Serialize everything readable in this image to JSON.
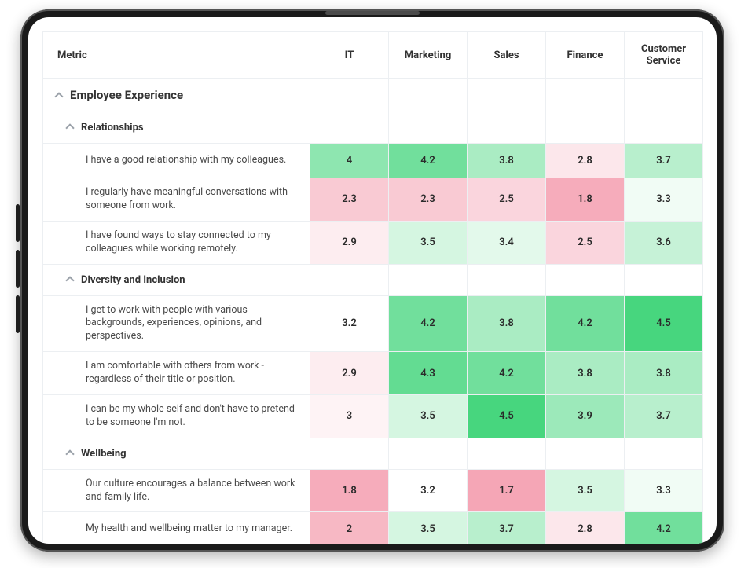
{
  "chart_data": {
    "type": "heatmap",
    "title": "Employee Experience",
    "columns": [
      "IT",
      "Marketing",
      "Sales",
      "Finance",
      "Customer Service"
    ],
    "color_scale": {
      "low": 1.5,
      "mid": 3.2,
      "high": 4.5,
      "low_color": "#f49aac",
      "mid_color": "#ffffff",
      "high_color": "#47d67e"
    },
    "sections": [
      {
        "name": "Relationships",
        "rows": [
          {
            "metric": "I have a good relationship with my colleagues.",
            "values": [
              4,
              4.2,
              3.8,
              2.8,
              3.7
            ]
          },
          {
            "metric": "I regularly have meaningful conversations with someone from work.",
            "values": [
              2.3,
              2.3,
              2.5,
              1.8,
              3.3
            ]
          },
          {
            "metric": "I have found ways to stay connected to my colleagues while working remotely.",
            "values": [
              2.9,
              3.5,
              3.4,
              2.5,
              3.6
            ]
          }
        ]
      },
      {
        "name": "Diversity and Inclusion",
        "rows": [
          {
            "metric": "I get to work with people with various backgrounds, experiences, opinions, and perspectives.",
            "values": [
              3.2,
              4.2,
              3.8,
              4.2,
              4.5
            ]
          },
          {
            "metric": "I am comfortable with others from work - regardless of their title or position.",
            "values": [
              2.9,
              4.3,
              4.2,
              3.8,
              3.8
            ]
          },
          {
            "metric": "I can be my whole self and don't have to pretend to be someone I'm not.",
            "values": [
              3,
              3.5,
              4.5,
              3.9,
              3.7
            ]
          }
        ]
      },
      {
        "name": "Wellbeing",
        "rows": [
          {
            "metric": "Our culture encourages a balance between work and family life.",
            "values": [
              1.8,
              3.2,
              1.7,
              3.5,
              3.3
            ]
          },
          {
            "metric": "My health and wellbeing matter to my manager.",
            "values": [
              2,
              3.5,
              3.7,
              2.8,
              4.2
            ]
          }
        ]
      }
    ]
  },
  "header": {
    "metric_label": "Metric"
  }
}
